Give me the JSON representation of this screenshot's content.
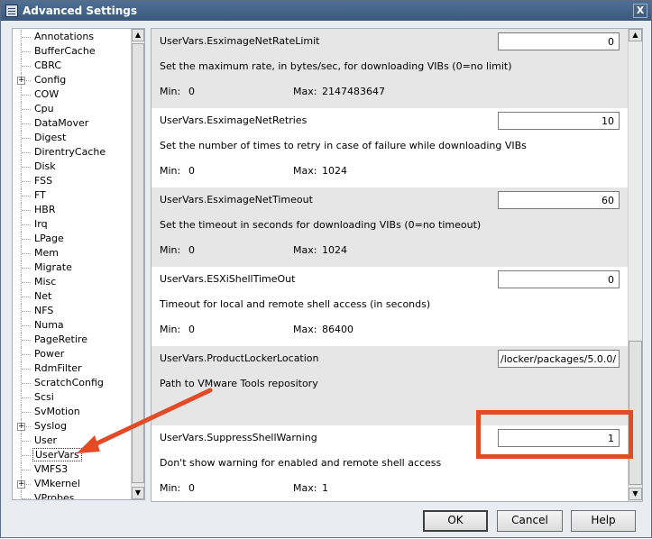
{
  "window": {
    "title": "Advanced Settings",
    "close_glyph": "X"
  },
  "tree": {
    "items": [
      {
        "label": "Annotations",
        "expandable": false
      },
      {
        "label": "BufferCache",
        "expandable": false
      },
      {
        "label": "CBRC",
        "expandable": false
      },
      {
        "label": "Config",
        "expandable": true
      },
      {
        "label": "COW",
        "expandable": false
      },
      {
        "label": "Cpu",
        "expandable": false
      },
      {
        "label": "DataMover",
        "expandable": false
      },
      {
        "label": "Digest",
        "expandable": false
      },
      {
        "label": "DirentryCache",
        "expandable": false
      },
      {
        "label": "Disk",
        "expandable": false
      },
      {
        "label": "FSS",
        "expandable": false
      },
      {
        "label": "FT",
        "expandable": false
      },
      {
        "label": "HBR",
        "expandable": false
      },
      {
        "label": "Irq",
        "expandable": false
      },
      {
        "label": "LPage",
        "expandable": false
      },
      {
        "label": "Mem",
        "expandable": false
      },
      {
        "label": "Migrate",
        "expandable": false
      },
      {
        "label": "Misc",
        "expandable": false
      },
      {
        "label": "Net",
        "expandable": false
      },
      {
        "label": "NFS",
        "expandable": false
      },
      {
        "label": "Numa",
        "expandable": false
      },
      {
        "label": "PageRetire",
        "expandable": false
      },
      {
        "label": "Power",
        "expandable": false
      },
      {
        "label": "RdmFilter",
        "expandable": false
      },
      {
        "label": "ScratchConfig",
        "expandable": false
      },
      {
        "label": "Scsi",
        "expandable": false
      },
      {
        "label": "SvMotion",
        "expandable": false
      },
      {
        "label": "Syslog",
        "expandable": true
      },
      {
        "label": "User",
        "expandable": false
      },
      {
        "label": "UserVars",
        "expandable": false,
        "selected": true
      },
      {
        "label": "VMFS3",
        "expandable": false
      },
      {
        "label": "VMkernel",
        "expandable": true
      },
      {
        "label": "VProbes",
        "expandable": false
      }
    ],
    "expand_glyph": "+"
  },
  "settings": [
    {
      "name": "UserVars.EsximageNetRateLimit",
      "value": "0",
      "description": "Set the maximum rate, in bytes/sec, for downloading VIBs (0=no limit)",
      "min_label": "Min:",
      "min": "0",
      "max_label": "Max:",
      "max": "2147483647"
    },
    {
      "name": "UserVars.EsximageNetRetries",
      "value": "10",
      "description": "Set the number of times to retry in case of failure while downloading VIBs",
      "min_label": "Min:",
      "min": "0",
      "max_label": "Max:",
      "max": "1024"
    },
    {
      "name": "UserVars.EsximageNetTimeout",
      "value": "60",
      "description": "Set the timeout in seconds for downloading VIBs (0=no timeout)",
      "min_label": "Min:",
      "min": "0",
      "max_label": "Max:",
      "max": "1024"
    },
    {
      "name": "UserVars.ESXiShellTimeOut",
      "value": "0",
      "description": "Timeout for local and remote shell access (in seconds)",
      "min_label": "Min:",
      "min": "0",
      "max_label": "Max:",
      "max": "86400"
    },
    {
      "name": "UserVars.ProductLockerLocation",
      "value": "/locker/packages/5.0.0/",
      "description": "Path to VMware Tools repository"
    },
    {
      "name": "UserVars.SuppressShellWarning",
      "value": "1",
      "description": "Don't show warning for enabled and remote shell access",
      "min_label": "Min:",
      "min": "0",
      "max_label": "Max:",
      "max": "1"
    }
  ],
  "buttons": {
    "ok": "OK",
    "cancel": "Cancel",
    "help": "Help"
  },
  "scroll_glyphs": {
    "up": "▲",
    "down": "▼"
  },
  "colors": {
    "annotation": "#e34a26",
    "titlebar": "#3a587c",
    "row_shade": "#e6e6e6"
  }
}
